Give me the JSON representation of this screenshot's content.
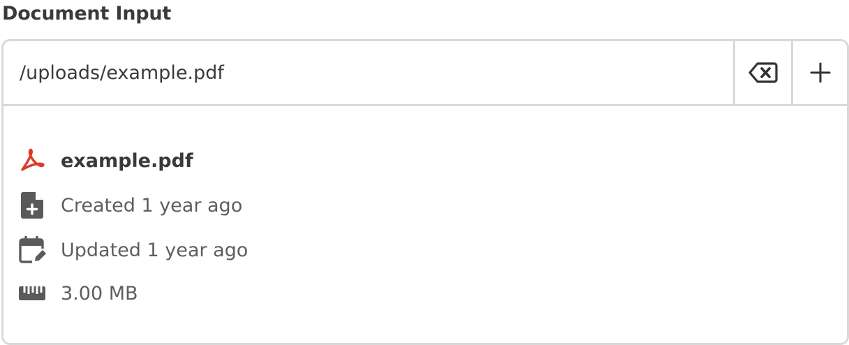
{
  "field": {
    "label": "Document Input"
  },
  "input": {
    "value": "/uploads/example.pdf",
    "placeholder": ""
  },
  "actions": {
    "clear_icon": "backspace-clear-icon",
    "add_icon": "plus-icon"
  },
  "file": {
    "name": "example.pdf",
    "name_icon": "acrobat-pdf-icon",
    "created": "Created 1 year ago",
    "created_icon": "file-plus-icon",
    "updated": "Updated 1 year ago",
    "updated_icon": "calendar-edit-icon",
    "size": "3.00 MB",
    "size_icon": "ruler-icon"
  },
  "colors": {
    "pdf_red": "#e0362b",
    "icon_gray": "#5a5a5a",
    "border": "#d9d9d9"
  }
}
